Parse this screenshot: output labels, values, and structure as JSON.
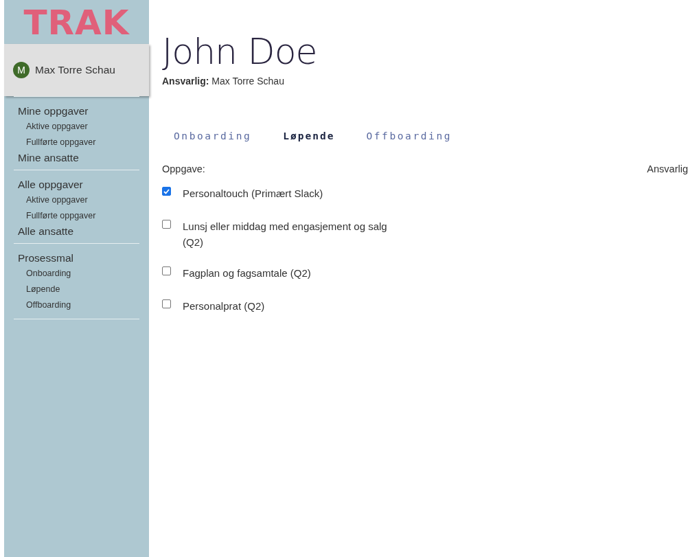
{
  "sidebar": {
    "logo": "TRAK",
    "user": {
      "initial": "M",
      "name": "Max Torre Schau"
    },
    "sections": [
      {
        "items": [
          {
            "label": "Mine oppgaver",
            "kind": "heading"
          },
          {
            "label": "Aktive oppgaver",
            "kind": "sub"
          },
          {
            "label": "Fullførte oppgaver",
            "kind": "sub"
          },
          {
            "label": "Mine ansatte",
            "kind": "heading"
          }
        ]
      },
      {
        "items": [
          {
            "label": "Alle oppgaver",
            "kind": "heading"
          },
          {
            "label": "Aktive oppgaver",
            "kind": "sub"
          },
          {
            "label": "Fullførte oppgaver",
            "kind": "sub"
          },
          {
            "label": "Alle ansatte",
            "kind": "heading"
          }
        ]
      },
      {
        "items": [
          {
            "label": "Prosessmal",
            "kind": "heading"
          },
          {
            "label": "Onboarding",
            "kind": "sub"
          },
          {
            "label": "Løpende",
            "kind": "sub"
          },
          {
            "label": "Offboarding",
            "kind": "sub"
          }
        ]
      }
    ]
  },
  "header": {
    "title": "John Doe",
    "responsible": "**Ansvarlig:** Max Torre Schau"
  },
  "tabs": [
    {
      "label": "Onboarding",
      "selected": false
    },
    {
      "label": "Løpende",
      "selected": true
    },
    {
      "label": "Offboarding",
      "selected": false
    }
  ],
  "table": {
    "columns": [
      "Oppgave:",
      "Ansvarlig"
    ],
    "tasks": [
      {
        "label": "Personaltouch (Primært Slack)",
        "checked": true
      },
      {
        "label": "Lunsj eller middag med engasjement og salg (Q2)",
        "checked": false
      },
      {
        "label": "Fagplan og fagsamtale (Q2)",
        "checked": false
      },
      {
        "label": "Personalprat (Q2)",
        "checked": false
      }
    ]
  }
}
